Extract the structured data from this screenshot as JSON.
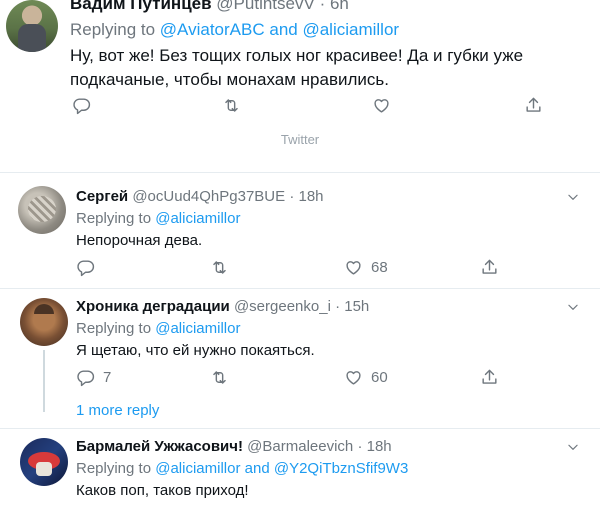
{
  "main_tweet": {
    "name": "Вадим Путинцев",
    "handle": "@PutintsevV",
    "time": "6h",
    "replying_prefix": "Replying to",
    "mention1": "@AviatorABC",
    "and": "and",
    "mention2": "@aliciamillor",
    "text": "Ну, вот же! Без тощих голых ног красивее! Да и губки уже подкачаные, чтобы монахам нравились."
  },
  "source_label": "Twitter",
  "replies": [
    {
      "name": "Сергей",
      "handle": "@ocUud4QhPg37BUE",
      "time": "18h",
      "replying_prefix": "Replying to",
      "mention1": "@aliciamillor",
      "text": "Непорочная дева.",
      "reply_count": "",
      "like_count": "68"
    },
    {
      "name": "Хроника деградации",
      "handle": "@sergeenko_i",
      "time": "15h",
      "replying_prefix": "Replying to",
      "mention1": "@aliciamillor",
      "text": "Я щетаю, что ей нужно покаяться.",
      "reply_count": "7",
      "like_count": "60",
      "more_replies": "1 more reply"
    },
    {
      "name": "Бармалей Ужжасович!",
      "handle": "@Barmaleevich",
      "time": "18h",
      "replying_prefix": "Replying to",
      "mention1": "@aliciamillor",
      "and": "and",
      "mention2": "@Y2QiTbznSfif9W3",
      "text": "Каков поп, таков приход!"
    }
  ],
  "sep": "·",
  "icons": [
    "reply-icon",
    "retweet-icon",
    "like-icon",
    "share-icon",
    "chevron-down-icon"
  ],
  "colors": {
    "accent": "#1d9bf0",
    "muted": "#6e767d",
    "divider": "#e6ecf0"
  }
}
